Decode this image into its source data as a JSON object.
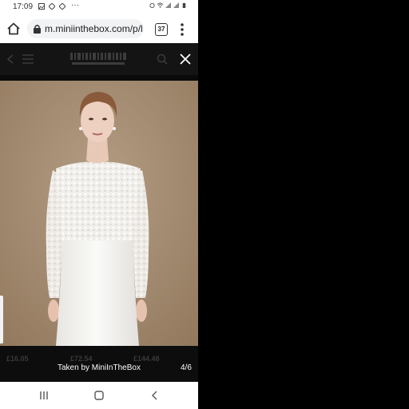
{
  "status_bar": {
    "time": "17:09",
    "overflow": "···"
  },
  "browser": {
    "url": "m.miniinthebox.com/p/l",
    "tab_count": "37"
  },
  "site": {
    "logo_text": "MiniInTheBox.com"
  },
  "caption": {
    "text": "Taken by MiniInTheBox",
    "counter": "4/6"
  },
  "background_prices": [
    "£16.05",
    "£72.54",
    "£144.48"
  ],
  "colors": {
    "overlay": "#0d0d0d",
    "photo_background": "#a88e72"
  },
  "icons": [
    "home-icon",
    "lock-icon",
    "tabs-icon",
    "more-vert-icon",
    "close-icon",
    "recents-icon",
    "home-nav-icon",
    "back-icon"
  ]
}
